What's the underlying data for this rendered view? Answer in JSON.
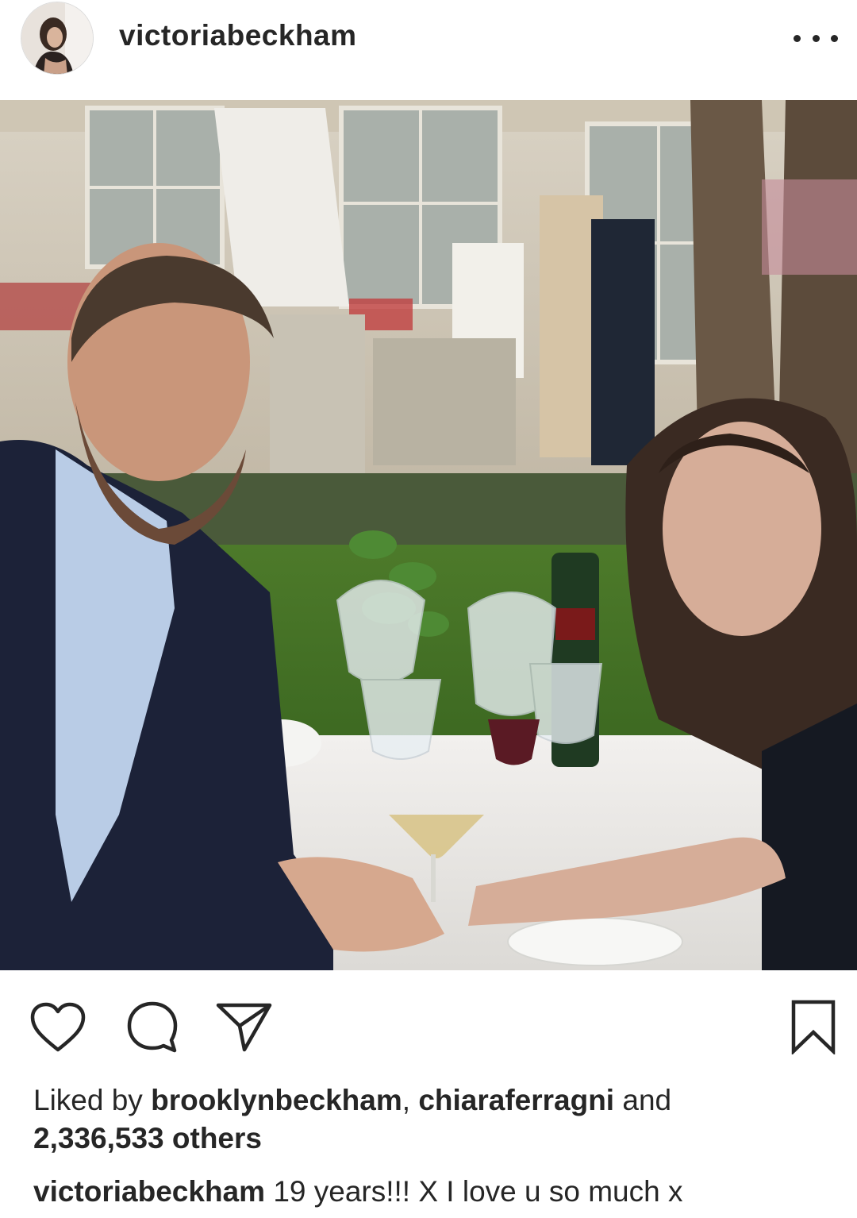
{
  "post": {
    "username": "victoriabeckham",
    "more_icon": "more-horizontal-icon",
    "photo_subject": "couple-dining-photo"
  },
  "actions": {
    "like_icon": "heart-icon",
    "comment_icon": "comment-icon",
    "share_icon": "send-icon",
    "save_icon": "bookmark-icon"
  },
  "likes": {
    "prefix": "Liked by",
    "user1": "brooklynbeckham",
    "separator": ",",
    "user2": "chiaraferragni",
    "and_text": "and",
    "count": "2,336,533",
    "others_text": "others"
  },
  "caption": {
    "username": "victoriabeckham",
    "text": "19 years!!! X I love u so much x"
  },
  "colors": {
    "text": "#262626",
    "background": "#ffffff",
    "icon": "#262626"
  }
}
